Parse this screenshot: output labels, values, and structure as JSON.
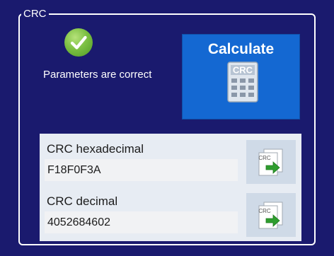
{
  "group": {
    "title": "CRC"
  },
  "status": {
    "icon": "checkmark-icon",
    "text": "Parameters are correct"
  },
  "calculate": {
    "label": "Calculate",
    "icon": "calculator-icon",
    "icon_text": "CRC"
  },
  "results": {
    "hex": {
      "label": "CRC hexadecimal",
      "value": "F18F0F3A",
      "copy_icon": "copy-to-clipboard-icon",
      "icon_text": "CRC"
    },
    "dec": {
      "label": "CRC decimal",
      "value": "4052684602",
      "copy_icon": "copy-to-clipboard-icon",
      "icon_text": "CRC"
    }
  },
  "colors": {
    "background": "#1a1a6e",
    "button": "#1468d2",
    "results_panel": "#e7ecf3",
    "success_green": "#7cc043",
    "arrow_green": "#2e9d2e"
  }
}
